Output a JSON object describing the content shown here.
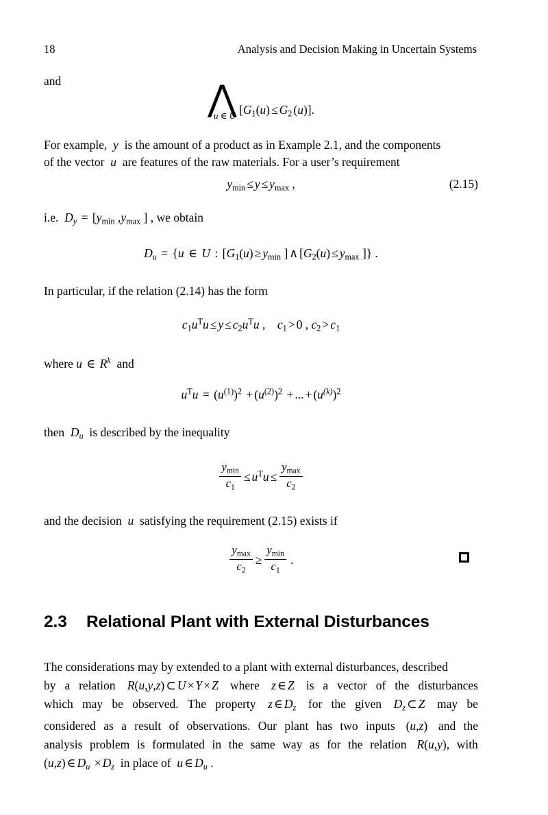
{
  "document": {
    "page_number": "18",
    "running_head": "Analysis and Decision Making in Uncertain Systems"
  },
  "blocks": {
    "and_word": "and",
    "eq_conjunction": {
      "limit": "u ∈ U",
      "body": "[G₁(u) ≤ G₂(u)]."
    },
    "para_example": {
      "line1": "For example,  y  is the amount of a product as in Example 2.1, and the components",
      "line2": "of the vector  u  are features of the raw materials. For a user’s requirement"
    },
    "eq_215": {
      "body": "y_min ≤ y ≤ y_max ,",
      "number": "(2.15)"
    },
    "line_ie": "i.e.  D_y = [ y_min , y_max ] , we obtain",
    "eq_du": "D_u = {u ∈ U : [G₁(u) ≥ y_min] ∧ [G₂(u) ≤ y_max]} .",
    "line_inparticular": "In particular, if the relation (2.14) has the form",
    "eq_quadform": "c₁uᵀu ≤ y ≤ c₂uᵀu ,    c₁ > 0 , c₂ > c₁",
    "line_where": "where u ∈ Rᵏ  and",
    "eq_norm": "uᵀu = (u⁽¹⁾)² + (u⁽²⁾)² + ... + (u⁽ᵏ⁾)²",
    "line_then": "then  D_u  is described by the inequality",
    "eq_ineq": "y_min / c₁ ≤ uᵀu ≤ y_max / c₂",
    "line_decision": "and the decision  u  satisfying the requirement (2.15) exists if",
    "eq_exist": "y_max / c₂ ≥ y_min / c₁ .",
    "qed_symbol": "□"
  },
  "section": {
    "number": "2.3",
    "title": "Relational Plant with External Disturbances"
  },
  "body_paragraph": {
    "line1": "The considerations may by extended to a plant with external disturbances, described",
    "line2": "by a relation  R(u, y, z) ⊂ U × Y × Z  where  z ∈ Z  is a vector of the disturbances",
    "line3": "which may be observed. The property  z ∈ D_z  for the given  D_z ⊂ Z  may be",
    "line4": "considered as a result of observations. Our plant has two inputs  (u, z)  and the",
    "line5": "analysis problem is formulated in the same way as for the relation  R(u, y) , with",
    "line6": "(u, z) ∈ D_u × D_z  in place of  u ∈ D_u ."
  },
  "math_symbols": {
    "big_wedge": "⋀",
    "leq": "≤",
    "geq": "≥",
    "in": "∈",
    "wedge": "∧",
    "subset": "⊂",
    "times": "×"
  }
}
